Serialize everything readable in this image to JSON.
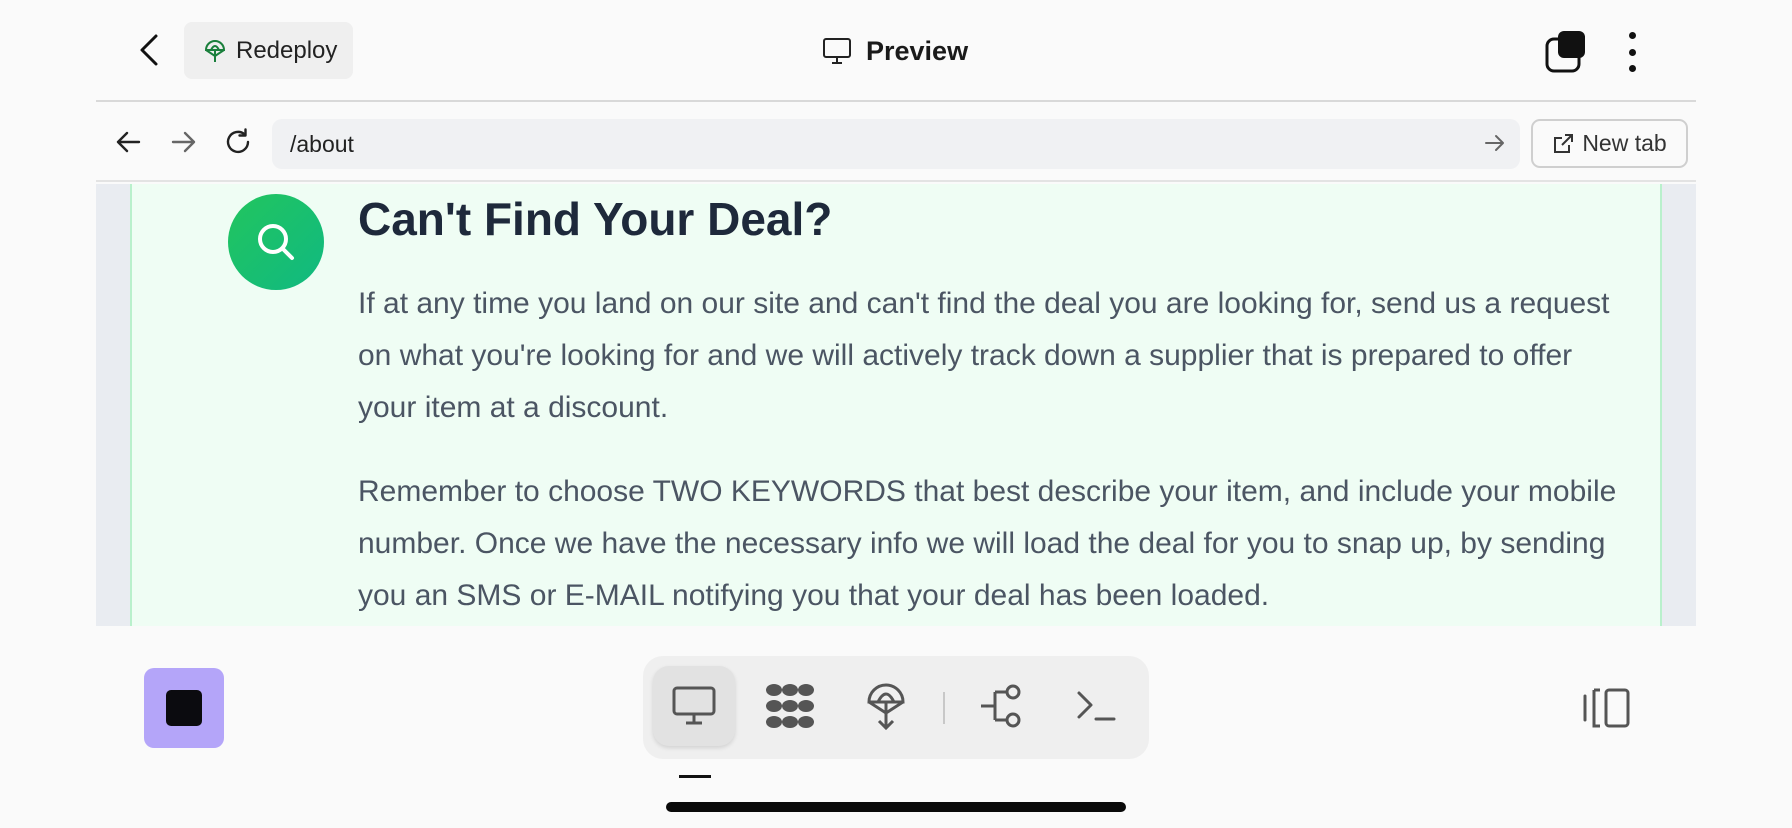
{
  "header": {
    "redeploy_label": "Redeploy",
    "title": "Preview"
  },
  "browser": {
    "url": "/about",
    "new_tab_label": "New tab"
  },
  "content": {
    "heading": "Can't Find Your Deal?",
    "paragraph1": "If at any time you land on our site and can't find the deal you are looking for, send us a request on what you're looking for and we will actively track down a supplier that is prepared to offer your item at a discount.",
    "paragraph2": "Remember to choose TWO KEYWORDS that best describe your item, and include your mobile number. Once we have the necessary info we will load the deal for you to snap up, by sending you an SMS or E-MAIL notifying you that your deal has been loaded."
  },
  "dock": {
    "items": [
      "preview-icon",
      "apps-icon",
      "deploy-icon",
      "git-branch-icon",
      "terminal-icon"
    ],
    "active": "preview-icon"
  },
  "colors": {
    "accent_stop": "#b4a5f9",
    "card_bg": "#effdf4",
    "badge_green": "#22c55e",
    "heading": "#1e293b",
    "body_text": "#4b5563"
  }
}
